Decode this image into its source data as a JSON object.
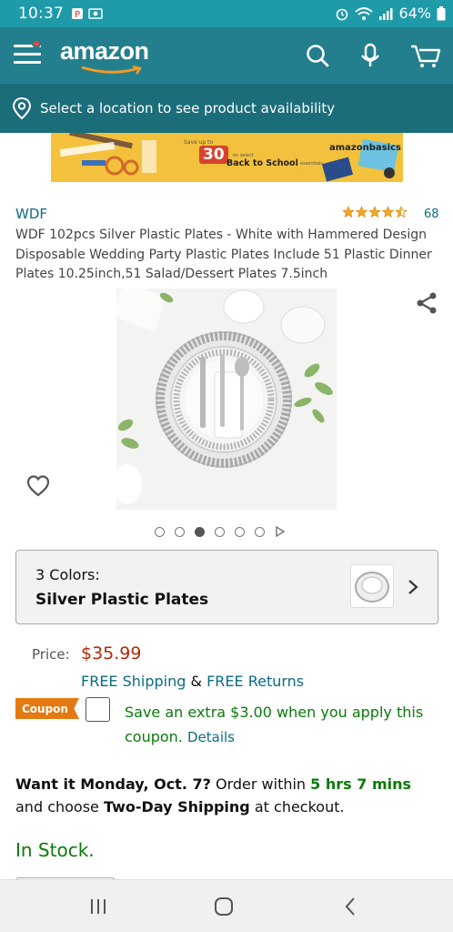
{
  "status": {
    "time": "10:37",
    "battery": "64%"
  },
  "header": {
    "logo": "amazon"
  },
  "location": {
    "text": "Select a location to see product availability"
  },
  "banner": {
    "save_up_to": "Save up to",
    "percent": "30",
    "on_select": "on select",
    "headline": "Back to School",
    "essentials": "essentials",
    "brand": "amazonbasics"
  },
  "product": {
    "brand": "WDF",
    "rating_stars": 4.5,
    "rating_count": "68",
    "title": "WDF 102pcs Silver Plastic Plates - White with Hammered Design Disposable Wedding Party Plastic Plates Include 51 Plastic Dinner Plates 10.25inch,51 Salad/Dessert Plates 7.5inch",
    "image_count": 6,
    "active_image": 3
  },
  "variant": {
    "count_label": "3 Colors:",
    "selected": "Silver Plastic Plates"
  },
  "price": {
    "label": "Price:",
    "value": "$35.99"
  },
  "shipping": {
    "free_shipping": "FREE Shipping",
    "amp": " & ",
    "free_returns": "FREE Returns"
  },
  "coupon": {
    "badge": "Coupon",
    "text": "Save an extra $3.00 when you apply this coupon.",
    "details": "Details"
  },
  "delivery": {
    "want_it": "Want it Monday, Oct. 7?",
    "order_within": " Order within ",
    "time_left": "5 hrs 7 mins",
    "and": " and choose ",
    "method": "Two-Day Shipping",
    "at_checkout": " at checkout."
  },
  "stock": {
    "status": "In Stock."
  },
  "colors": {
    "header": "#237f8d",
    "status": "#1f9aa8",
    "location": "#1b6d79",
    "price": "#b12704",
    "green": "#0a7a0a",
    "link": "#0c6b85",
    "coupon": "#e47911"
  }
}
